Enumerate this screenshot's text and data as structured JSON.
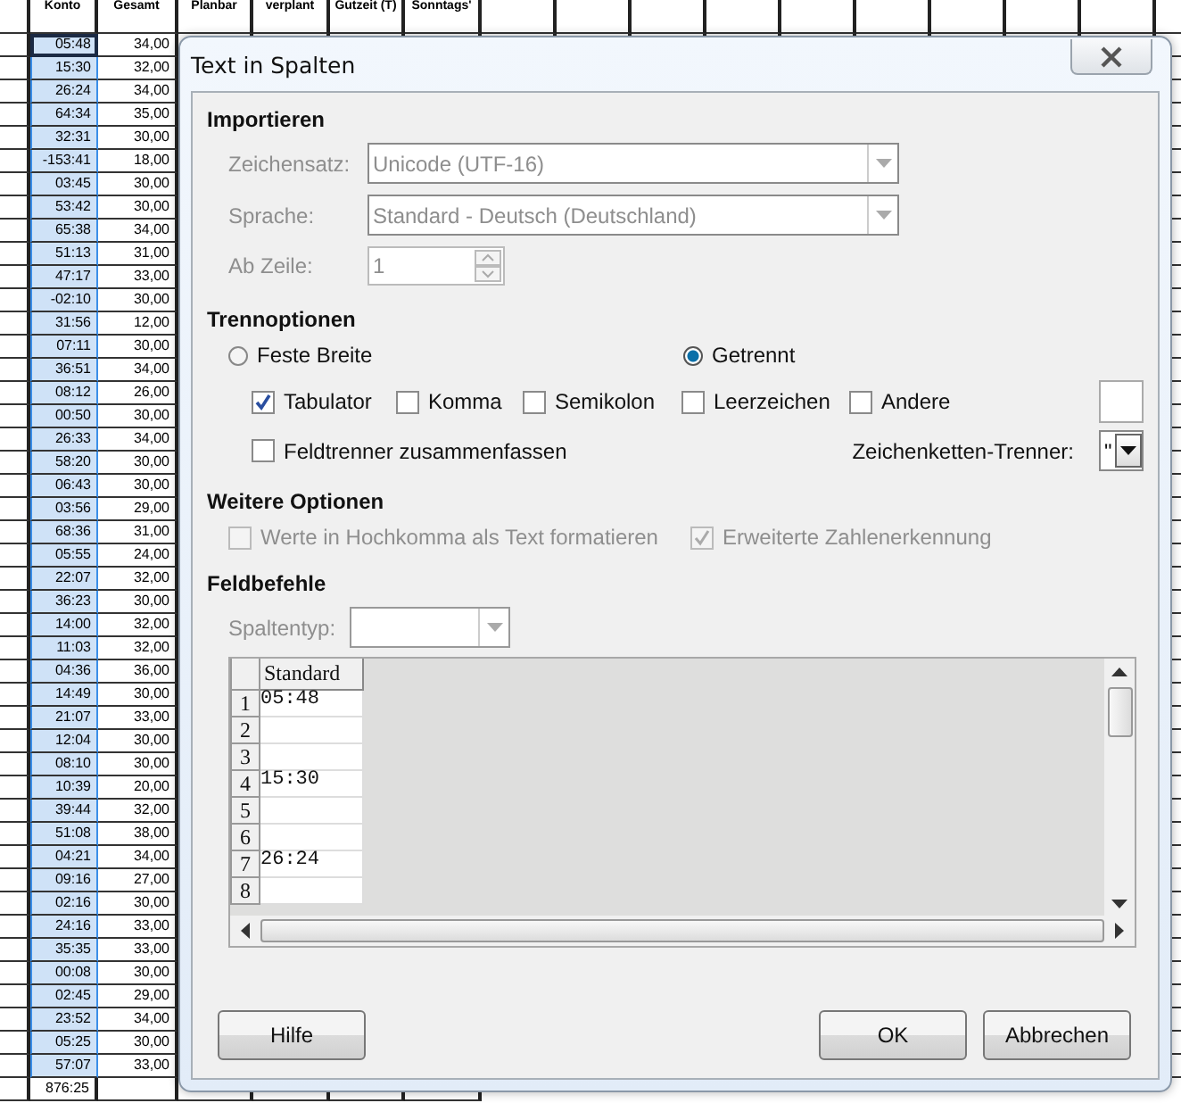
{
  "sheet": {
    "columns": [
      {
        "label": "Konto",
        "selected": true
      },
      {
        "label": "Gesamt",
        "selected": false
      },
      {
        "label": "Planbar",
        "selected": false
      },
      {
        "label": "verplant",
        "selected": false
      },
      {
        "label": "Gutzeit (T)",
        "selected": false
      },
      {
        "label": "Sonntags'",
        "selected": false
      }
    ],
    "rows": [
      {
        "cells": [
          "05:48",
          "34,00"
        ]
      },
      {
        "cells": [
          "15:30",
          "32,00"
        ]
      },
      {
        "cells": [
          "26:24",
          "34,00"
        ]
      },
      {
        "cells": [
          "64:34",
          "35,00"
        ]
      },
      {
        "cells": [
          "32:31",
          "30,00"
        ]
      },
      {
        "cells": [
          "-153:41",
          "18,00"
        ]
      },
      {
        "cells": [
          "03:45",
          "30,00"
        ]
      },
      {
        "cells": [
          "53:42",
          "30,00"
        ]
      },
      {
        "cells": [
          "65:38",
          "34,00"
        ]
      },
      {
        "cells": [
          "51:13",
          "31,00"
        ]
      },
      {
        "cells": [
          "47:17",
          "33,00"
        ]
      },
      {
        "cells": [
          "-02:10",
          "30,00"
        ]
      },
      {
        "cells": [
          "31:56",
          "12,00"
        ]
      },
      {
        "cells": [
          "07:11",
          "30,00"
        ]
      },
      {
        "cells": [
          "36:51",
          "34,00"
        ]
      },
      {
        "cells": [
          "08:12",
          "26,00"
        ]
      },
      {
        "cells": [
          "00:50",
          "30,00"
        ]
      },
      {
        "cells": [
          "26:33",
          "34,00"
        ]
      },
      {
        "cells": [
          "58:20",
          "30,00"
        ]
      },
      {
        "cells": [
          "06:43",
          "30,00"
        ]
      },
      {
        "cells": [
          "03:56",
          "29,00"
        ]
      },
      {
        "cells": [
          "68:36",
          "31,00"
        ]
      },
      {
        "cells": [
          "05:55",
          "24,00"
        ]
      },
      {
        "cells": [
          "22:07",
          "32,00"
        ]
      },
      {
        "cells": [
          "36:23",
          "30,00"
        ]
      },
      {
        "cells": [
          "14:00",
          "32,00"
        ]
      },
      {
        "cells": [
          "11:03",
          "32,00"
        ]
      },
      {
        "cells": [
          "04:36",
          "36,00"
        ]
      },
      {
        "cells": [
          "14:49",
          "30,00"
        ]
      },
      {
        "cells": [
          "21:07",
          "33,00"
        ]
      },
      {
        "cells": [
          "12:04",
          "30,00"
        ]
      },
      {
        "cells": [
          "08:10",
          "30,00"
        ]
      },
      {
        "cells": [
          "10:39",
          "20,00"
        ]
      },
      {
        "cells": [
          "39:44",
          "32,00"
        ]
      },
      {
        "cells": [
          "51:08",
          "38,00"
        ]
      },
      {
        "cells": [
          "04:21",
          "34,00"
        ]
      },
      {
        "cells": [
          "09:16",
          "27,00"
        ]
      },
      {
        "cells": [
          "02:16",
          "30,00"
        ]
      },
      {
        "cells": [
          "24:16",
          "33,00"
        ]
      },
      {
        "cells": [
          "35:35",
          "33,00"
        ]
      },
      {
        "cells": [
          "00:08",
          "30,00"
        ]
      },
      {
        "cells": [
          "02:45",
          "29,00"
        ]
      },
      {
        "cells": [
          "23:52",
          "34,00"
        ]
      },
      {
        "cells": [
          "05:25",
          "30,00"
        ]
      },
      {
        "cells": [
          "57:07",
          "33,00"
        ]
      }
    ],
    "total": [
      "876:25"
    ]
  },
  "dialog": {
    "title": "Text in Spalten",
    "import": {
      "heading": "Importieren",
      "fields": [
        {
          "kind": "dropdown",
          "label": "Zeichensatz:",
          "value": "Unicode (UTF-16)",
          "disabled": true
        },
        {
          "kind": "dropdown",
          "label": "Sprache:",
          "value": "Standard - Deutsch (Deutschland)",
          "disabled": true
        },
        {
          "kind": "spinner",
          "label": "Ab Zeile:",
          "value": "1",
          "disabled": true
        }
      ]
    },
    "separator": {
      "heading": "Trennoptionen",
      "modes": [
        {
          "label": "Feste Breite",
          "selected": false
        },
        {
          "label": "Getrennt",
          "selected": true
        }
      ],
      "separators": [
        {
          "label": "Tabulator",
          "checked": true
        },
        {
          "label": "Komma",
          "checked": false
        },
        {
          "label": "Semikolon",
          "checked": false
        },
        {
          "label": "Leerzeichen",
          "checked": false
        },
        {
          "label": "Andere",
          "checked": false
        }
      ],
      "merge": {
        "label": "Feldtrenner zusammenfassen",
        "checked": false
      },
      "text_delimiter": {
        "label": "Zeichenketten-Trenner:",
        "value": "\""
      }
    },
    "more": {
      "heading": "Weitere Optionen",
      "options": [
        {
          "label": "Werte in Hochkomma als Text formatieren",
          "checked": false,
          "disabled": true
        },
        {
          "label": "Erweiterte Zahlenerkennung",
          "checked": true,
          "disabled": true
        }
      ]
    },
    "fields": {
      "heading": "Feldbefehle",
      "column_type": {
        "label": "Spaltentyp:",
        "disabled": true
      },
      "preview": {
        "column": "Standard",
        "rows": [
          {
            "number": "1",
            "value": "05:48"
          },
          {
            "number": "2"
          },
          {
            "number": "3"
          },
          {
            "number": "4",
            "value": "15:30"
          },
          {
            "number": "5"
          },
          {
            "number": "6"
          },
          {
            "number": "7",
            "value": "26:24"
          },
          {
            "number": "8"
          }
        ]
      }
    },
    "buttons": [
      {
        "label": "Hilfe",
        "kind": "help"
      },
      {
        "label": "OK",
        "kind": "confirm"
      },
      {
        "label": "Abbrechen",
        "kind": "cancel"
      }
    ]
  }
}
